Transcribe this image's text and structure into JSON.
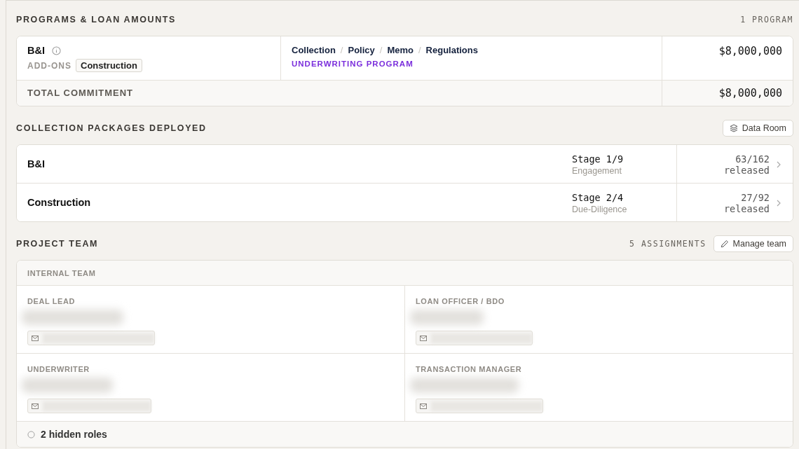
{
  "programs": {
    "title": "PROGRAMS & LOAN AMOUNTS",
    "count": "1 PROGRAM",
    "items": [
      {
        "name": "B&I",
        "addons_label": "ADD-ONS",
        "addons": [
          "Construction"
        ],
        "links": [
          "Collection",
          "Policy",
          "Memo",
          "Regulations"
        ],
        "separator": "/",
        "type_label": "UNDERWRITING PROGRAM",
        "amount": "$8,000,000"
      }
    ],
    "total": {
      "label": "TOTAL COMMITMENT",
      "amount": "$8,000,000"
    }
  },
  "packages": {
    "title": "COLLECTION PACKAGES DEPLOYED",
    "button": "Data Room",
    "rows": [
      {
        "name": "B&I",
        "stage": "Stage 1/9",
        "stage_name": "Engagement",
        "released": "63/162",
        "released_label": "released"
      },
      {
        "name": "Construction",
        "stage": "Stage 2/4",
        "stage_name": "Due-Diligence",
        "released": "27/92",
        "released_label": "released"
      }
    ]
  },
  "team": {
    "title": "PROJECT TEAM",
    "count": "5 ASSIGNMENTS",
    "button": "Manage team",
    "group": "INTERNAL TEAM",
    "roles": [
      {
        "role": "DEAL LEAD"
      },
      {
        "role": "LOAN OFFICER / BDO"
      },
      {
        "role": "UNDERWRITER"
      },
      {
        "role": "TRANSACTION MANAGER"
      }
    ],
    "footer": "2 hidden roles"
  }
}
